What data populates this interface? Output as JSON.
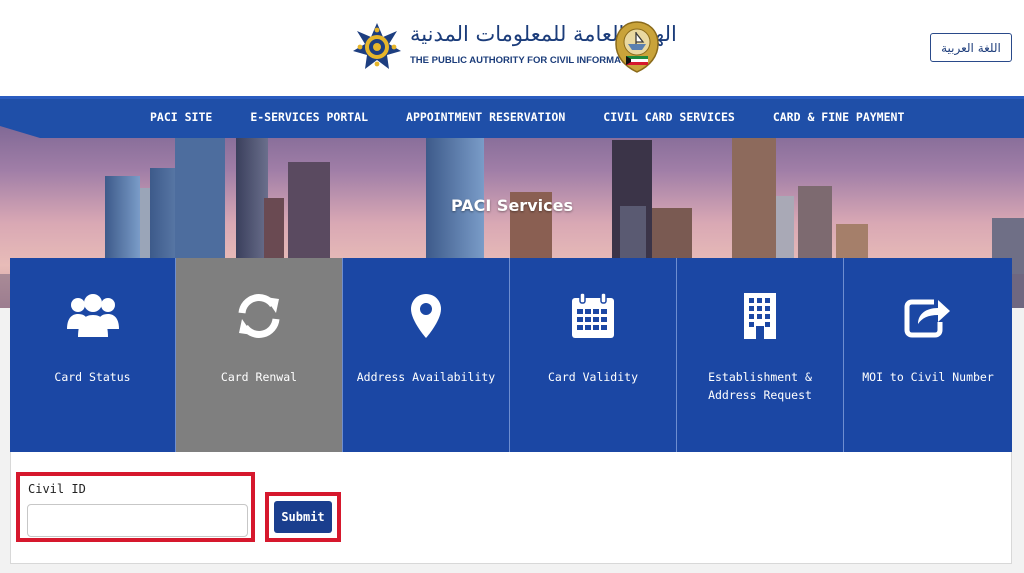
{
  "header": {
    "arabic_title": "الهيئة العامة للمعلومات المدنية",
    "english_title": "THE PUBLIC AUTHORITY FOR CIVIL INFORMATION",
    "language_button": "اللغة العربية",
    "logo_icon": "paci-star-logo-icon",
    "emblem_icon": "kuwait-emblem-icon"
  },
  "nav": {
    "items": [
      {
        "label": "PACI SITE"
      },
      {
        "label": "E-SERVICES PORTAL"
      },
      {
        "label": "APPOINTMENT RESERVATION"
      },
      {
        "label": "CIVIL CARD SERVICES"
      },
      {
        "label": "CARD & FINE PAYMENT"
      }
    ]
  },
  "banner": {
    "heading": "PACI Services"
  },
  "services": {
    "tiles": [
      {
        "label": "Card Status",
        "icon": "users-icon",
        "active": false
      },
      {
        "label": "Card Renwal",
        "icon": "refresh-icon",
        "active": true
      },
      {
        "label": "Address Availability",
        "icon": "map-pin-icon",
        "active": false
      },
      {
        "label": "Card Validity",
        "icon": "calendar-icon",
        "active": false
      },
      {
        "label": "Establishment & Address Request",
        "icon": "building-icon",
        "active": false
      },
      {
        "label": "MOI to Civil Number",
        "icon": "share-arrow-icon",
        "active": false
      }
    ]
  },
  "form": {
    "civil_id_label": "Civil ID",
    "civil_id_value": "",
    "submit_label": "Submit"
  },
  "colors": {
    "primary_blue": "#1b47a4",
    "nav_blue": "#1f4fa8",
    "active_tile": "#7f7f7f",
    "highlight_red": "#d6182d"
  }
}
